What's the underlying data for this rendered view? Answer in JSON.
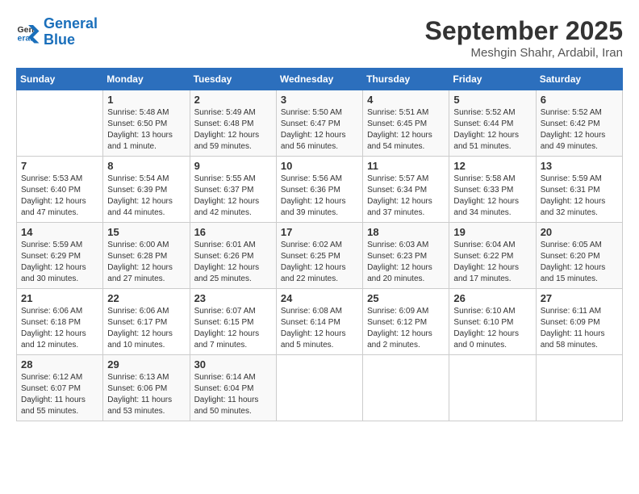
{
  "header": {
    "logo_line1": "General",
    "logo_line2": "Blue",
    "month": "September 2025",
    "location": "Meshgin Shahr, Ardabil, Iran"
  },
  "weekdays": [
    "Sunday",
    "Monday",
    "Tuesday",
    "Wednesday",
    "Thursday",
    "Friday",
    "Saturday"
  ],
  "weeks": [
    [
      {
        "day": "",
        "info": ""
      },
      {
        "day": "1",
        "info": "Sunrise: 5:48 AM\nSunset: 6:50 PM\nDaylight: 13 hours\nand 1 minute."
      },
      {
        "day": "2",
        "info": "Sunrise: 5:49 AM\nSunset: 6:48 PM\nDaylight: 12 hours\nand 59 minutes."
      },
      {
        "day": "3",
        "info": "Sunrise: 5:50 AM\nSunset: 6:47 PM\nDaylight: 12 hours\nand 56 minutes."
      },
      {
        "day": "4",
        "info": "Sunrise: 5:51 AM\nSunset: 6:45 PM\nDaylight: 12 hours\nand 54 minutes."
      },
      {
        "day": "5",
        "info": "Sunrise: 5:52 AM\nSunset: 6:44 PM\nDaylight: 12 hours\nand 51 minutes."
      },
      {
        "day": "6",
        "info": "Sunrise: 5:52 AM\nSunset: 6:42 PM\nDaylight: 12 hours\nand 49 minutes."
      }
    ],
    [
      {
        "day": "7",
        "info": "Sunrise: 5:53 AM\nSunset: 6:40 PM\nDaylight: 12 hours\nand 47 minutes."
      },
      {
        "day": "8",
        "info": "Sunrise: 5:54 AM\nSunset: 6:39 PM\nDaylight: 12 hours\nand 44 minutes."
      },
      {
        "day": "9",
        "info": "Sunrise: 5:55 AM\nSunset: 6:37 PM\nDaylight: 12 hours\nand 42 minutes."
      },
      {
        "day": "10",
        "info": "Sunrise: 5:56 AM\nSunset: 6:36 PM\nDaylight: 12 hours\nand 39 minutes."
      },
      {
        "day": "11",
        "info": "Sunrise: 5:57 AM\nSunset: 6:34 PM\nDaylight: 12 hours\nand 37 minutes."
      },
      {
        "day": "12",
        "info": "Sunrise: 5:58 AM\nSunset: 6:33 PM\nDaylight: 12 hours\nand 34 minutes."
      },
      {
        "day": "13",
        "info": "Sunrise: 5:59 AM\nSunset: 6:31 PM\nDaylight: 12 hours\nand 32 minutes."
      }
    ],
    [
      {
        "day": "14",
        "info": "Sunrise: 5:59 AM\nSunset: 6:29 PM\nDaylight: 12 hours\nand 30 minutes."
      },
      {
        "day": "15",
        "info": "Sunrise: 6:00 AM\nSunset: 6:28 PM\nDaylight: 12 hours\nand 27 minutes."
      },
      {
        "day": "16",
        "info": "Sunrise: 6:01 AM\nSunset: 6:26 PM\nDaylight: 12 hours\nand 25 minutes."
      },
      {
        "day": "17",
        "info": "Sunrise: 6:02 AM\nSunset: 6:25 PM\nDaylight: 12 hours\nand 22 minutes."
      },
      {
        "day": "18",
        "info": "Sunrise: 6:03 AM\nSunset: 6:23 PM\nDaylight: 12 hours\nand 20 minutes."
      },
      {
        "day": "19",
        "info": "Sunrise: 6:04 AM\nSunset: 6:22 PM\nDaylight: 12 hours\nand 17 minutes."
      },
      {
        "day": "20",
        "info": "Sunrise: 6:05 AM\nSunset: 6:20 PM\nDaylight: 12 hours\nand 15 minutes."
      }
    ],
    [
      {
        "day": "21",
        "info": "Sunrise: 6:06 AM\nSunset: 6:18 PM\nDaylight: 12 hours\nand 12 minutes."
      },
      {
        "day": "22",
        "info": "Sunrise: 6:06 AM\nSunset: 6:17 PM\nDaylight: 12 hours\nand 10 minutes."
      },
      {
        "day": "23",
        "info": "Sunrise: 6:07 AM\nSunset: 6:15 PM\nDaylight: 12 hours\nand 7 minutes."
      },
      {
        "day": "24",
        "info": "Sunrise: 6:08 AM\nSunset: 6:14 PM\nDaylight: 12 hours\nand 5 minutes."
      },
      {
        "day": "25",
        "info": "Sunrise: 6:09 AM\nSunset: 6:12 PM\nDaylight: 12 hours\nand 2 minutes."
      },
      {
        "day": "26",
        "info": "Sunrise: 6:10 AM\nSunset: 6:10 PM\nDaylight: 12 hours\nand 0 minutes."
      },
      {
        "day": "27",
        "info": "Sunrise: 6:11 AM\nSunset: 6:09 PM\nDaylight: 11 hours\nand 58 minutes."
      }
    ],
    [
      {
        "day": "28",
        "info": "Sunrise: 6:12 AM\nSunset: 6:07 PM\nDaylight: 11 hours\nand 55 minutes."
      },
      {
        "day": "29",
        "info": "Sunrise: 6:13 AM\nSunset: 6:06 PM\nDaylight: 11 hours\nand 53 minutes."
      },
      {
        "day": "30",
        "info": "Sunrise: 6:14 AM\nSunset: 6:04 PM\nDaylight: 11 hours\nand 50 minutes."
      },
      {
        "day": "",
        "info": ""
      },
      {
        "day": "",
        "info": ""
      },
      {
        "day": "",
        "info": ""
      },
      {
        "day": "",
        "info": ""
      }
    ]
  ]
}
